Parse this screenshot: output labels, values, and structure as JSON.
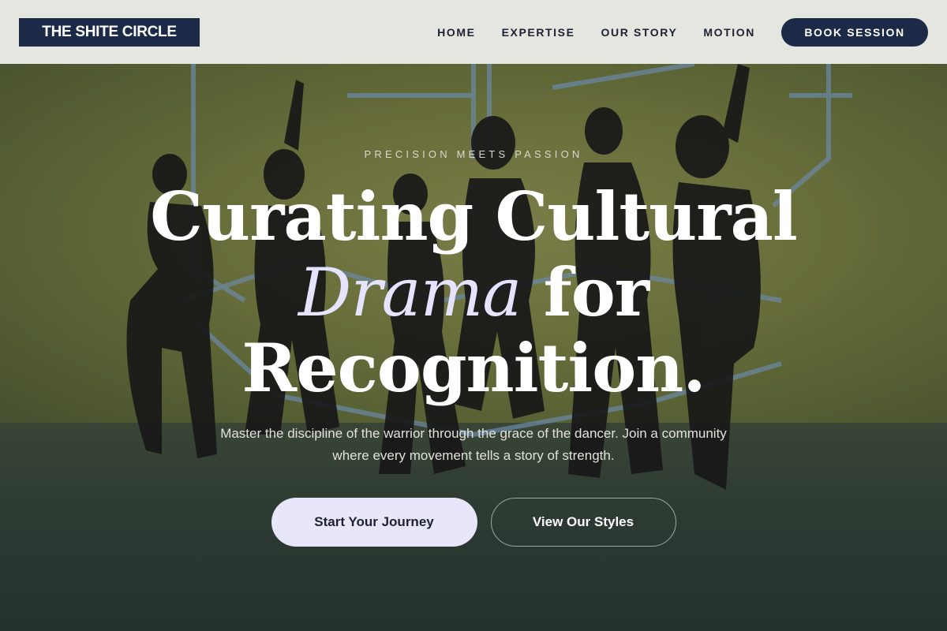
{
  "brand": {
    "name": "THE SHITE CIRCLE"
  },
  "nav": {
    "items": [
      {
        "label": "HOME"
      },
      {
        "label": "EXPERTISE"
      },
      {
        "label": "OUR STORY"
      },
      {
        "label": "MOTION"
      }
    ],
    "cta_label": "BOOK SESSION"
  },
  "hero": {
    "eyebrow": "PRECISION MEETS PASSION",
    "headline": {
      "line1": "Curating Cultural",
      "accent": "Drama",
      "line2_rest": " for",
      "line3": "Recognition."
    },
    "subtext": "Master the discipline of the warrior through the grace of the dancer. Join a community where every movement tells a story of strength.",
    "primary_cta": "Start Your Journey",
    "secondary_cta": "View Our Styles",
    "background_description_icon": "dancers-photo",
    "colors": {
      "accent": "#e8e6fb",
      "brand_navy": "#1c2a47",
      "header_bg": "#e6e6e1"
    }
  }
}
